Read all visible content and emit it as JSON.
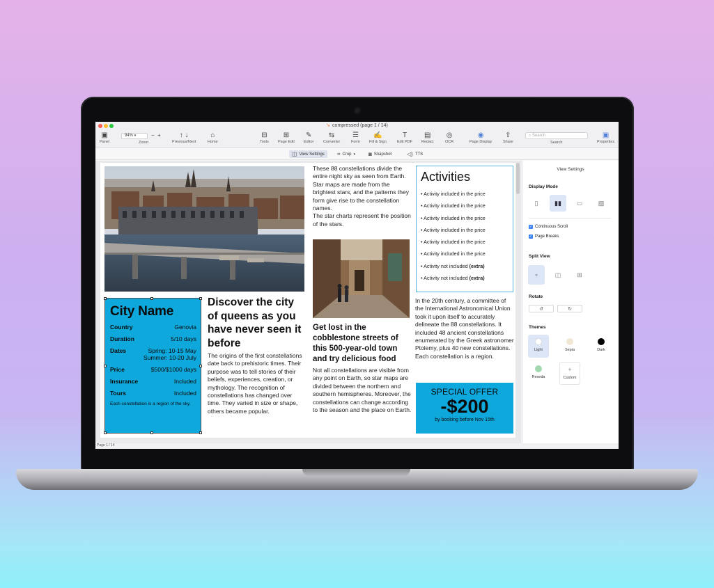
{
  "window": {
    "title": "compressed (page 1 / 14)"
  },
  "toolbar": {
    "panel": "Panel",
    "zoom_value": "94%",
    "zoom": "Zoom",
    "prev_next": "Previous/Next",
    "home": "Home",
    "tools": "Tools",
    "page_edit": "Page Edit",
    "editor": "Editor",
    "converter": "Converter",
    "form": "Form",
    "fill_sign": "Fill & Sign",
    "edit_pdf": "Edit PDF",
    "redact": "Redact",
    "ocr": "OCR",
    "page_display": "Page Display",
    "share": "Share",
    "search_placeholder": "Search",
    "search": "Search",
    "properties": "Properties"
  },
  "subbar": {
    "view_settings": "View Settings",
    "crop": "Crop",
    "snapshot": "Snapshot",
    "tts": "TTS"
  },
  "document": {
    "city_box": {
      "title": "City Name",
      "rows": [
        {
          "k": "Country",
          "v": "Genovia"
        },
        {
          "k": "Duration",
          "v": "5/10 days"
        },
        {
          "k": "Dates",
          "v": "Spring: 10-15 May Summer: 10-20 July"
        },
        {
          "k": "Price",
          "v": "$500/$1000 days"
        },
        {
          "k": "Insurance",
          "v": "Included"
        },
        {
          "k": "Tours",
          "v": "Included"
        }
      ],
      "note": "Each constellation is a region of the sky."
    },
    "headline1": "Discover the city of queens as you have never seen it before",
    "body1": "The origins of the first constellations date back to prehistoric times. Their purpose was to tell stories of their beliefs, experiences, creation, or mythology. The recognition of constellations has changed over time. They varied in size or shape, others became popular.",
    "body_top": "These 88 constellations divide the entire night sky as seen from Earth. Star maps are made from the brightest stars, and the patterns they form give rise to the constellation names.",
    "body_top2": "The star charts represent the position of the stars.",
    "headline2": "Get lost in the cobblestone streets of this 500-year-old town and try delicious food",
    "body2": "Not all constellations are visible from any point on Earth, so star maps are divided between the northern and southern hemispheres. Moreover, the constellations can change according to the season and the place on Earth.",
    "activities": {
      "title": "Activities",
      "included": "• Activity included in the price",
      "not_included_prefix": "• Activity not included ",
      "extra": "(extra)"
    },
    "body3": "In the 20th century, a committee of the International Astronomical Union took it upon itself to accurately delineate the 88 constellations. It included 48 ancient constellations enumerated by the Greek astronomer Ptolemy, plus 40 new constellations. Each constellation is a region.",
    "offer": {
      "title": "SPECIAL OFFER",
      "amount": "-$200",
      "sub": "by booking before Nov 15th"
    }
  },
  "status": {
    "page": "Page 1 / 14"
  },
  "panel": {
    "title": "View Settings",
    "display_mode": "Display Mode",
    "continuous_scroll": "Continuous Scroll",
    "page_breaks": "Page Breaks",
    "split_view": "Split View",
    "rotate": "Rotate",
    "themes": "Themes",
    "theme_list": [
      {
        "name": "Light",
        "color": "#ffffff"
      },
      {
        "name": "Sepia",
        "color": "#efe6d4"
      },
      {
        "name": "Dark",
        "color": "#000000"
      },
      {
        "name": "Reseda",
        "color": "#a3d9b0"
      },
      {
        "name": "Custom",
        "color": "#ffffff"
      }
    ]
  },
  "colors": {
    "accent_blue": "#0fa8dc",
    "frame_border": "#4fb5dd"
  }
}
